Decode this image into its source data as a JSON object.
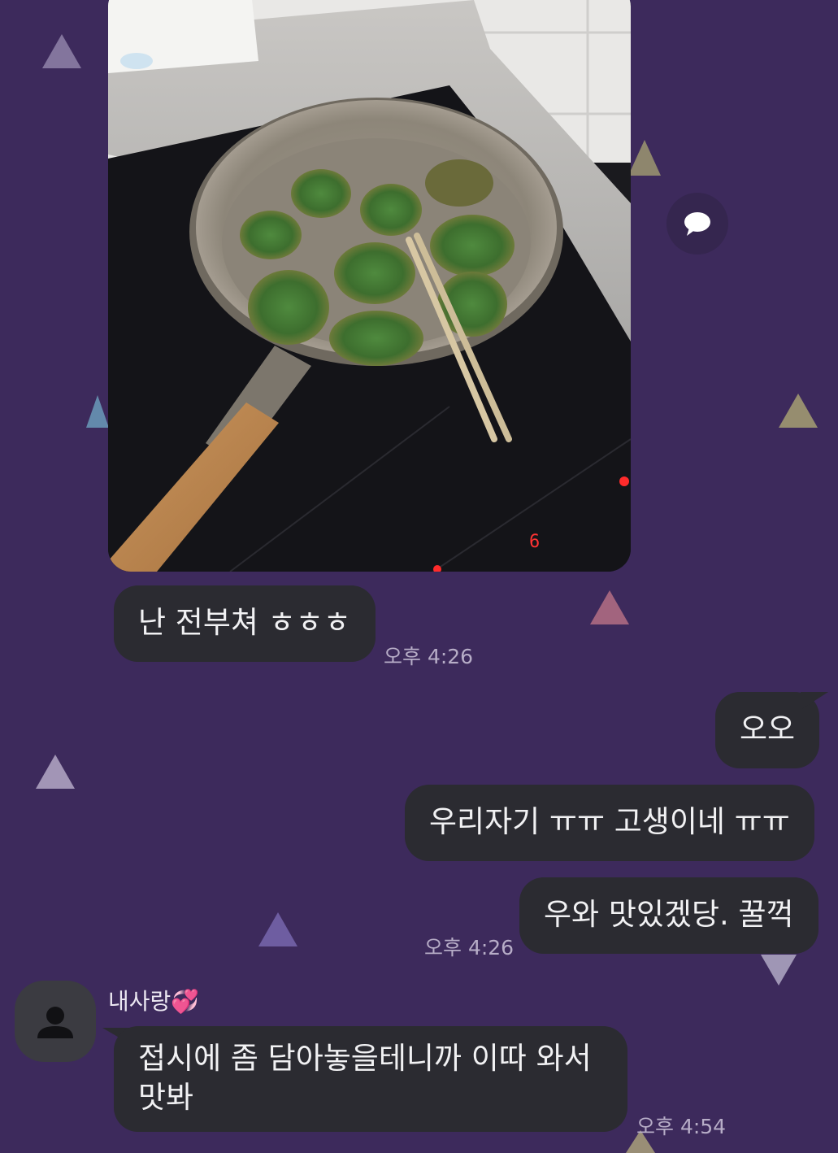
{
  "messages": {
    "m1": {
      "text": "난 전부쳐 ㅎㅎㅎ",
      "time": "오후 4:26"
    },
    "m2": {
      "text": "오오"
    },
    "m3": {
      "text": "우리자기 ㅠㅠ 고생이네 ㅠㅠ"
    },
    "m4": {
      "text": "우와 맛있겠당. 꿀꺽",
      "time": "오후 4:26"
    },
    "m5": {
      "sender": "내사랑",
      "sender_emoji": "💞",
      "line1": "접시에 좀 담아놓을테니까 이따 와서",
      "line2": "맛봐",
      "time": "오후 4:54"
    }
  },
  "icons": {
    "share": "speech-bubble-icon",
    "avatar": "person-icon"
  },
  "colors": {
    "background": "#3d2a5c",
    "bubble": "#2b2b31",
    "text": "#f1f1f3",
    "time": "#b7adc7"
  }
}
